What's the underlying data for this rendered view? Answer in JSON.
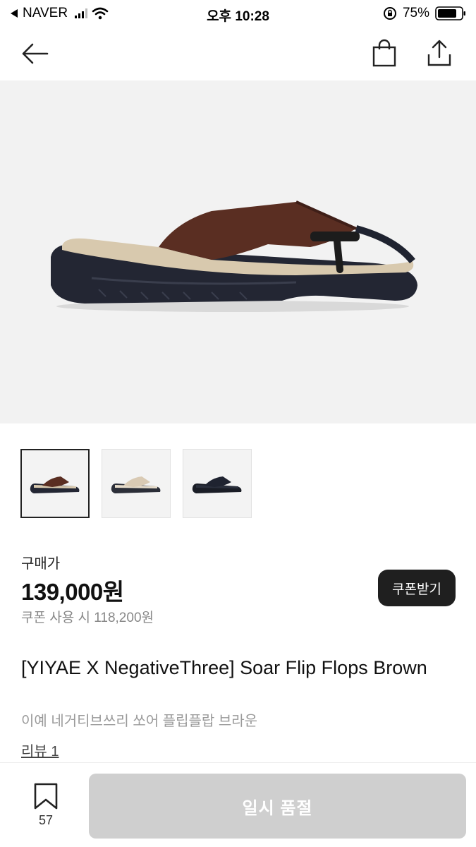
{
  "status_bar": {
    "back_app": "NAVER",
    "time": "오후 10:28",
    "battery": "75%"
  },
  "nav": {
    "back_icon": "arrow-left-icon",
    "bag_icon": "shopping-bag-icon",
    "share_icon": "share-icon"
  },
  "product": {
    "price_label": "구매가",
    "price": "139,000원",
    "coupon_price": "쿠폰 사용 시 118,200원",
    "coupon_button": "쿠폰받기",
    "title": "[YIYAE X NegativeThree] Soar Flip Flops Brown",
    "subtitle": "이예 네거티브쓰리 쏘어 플립플랍 브라운",
    "reviews": "리뷰 1"
  },
  "thumbnails": [
    {
      "color": "#5a2e22",
      "selected": true
    },
    {
      "color": "#d9cab4",
      "selected": false
    },
    {
      "color": "#1f2330",
      "selected": false
    }
  ],
  "bottom": {
    "bookmark_count": "57",
    "action_label": "일시 품절"
  }
}
